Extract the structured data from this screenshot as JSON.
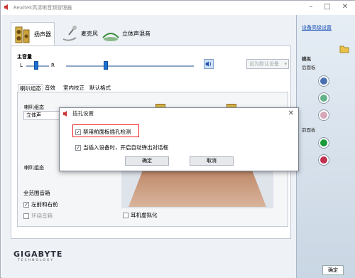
{
  "window": {
    "title": "Realtek高清晰音频管理器"
  },
  "device_tabs": [
    {
      "label": "扬声器"
    },
    {
      "label": "麦克风"
    },
    {
      "label": "立体声混音"
    }
  ],
  "master_volume": {
    "label": "主音量",
    "left": "L",
    "right": "R",
    "set_default_label": "设为默认设备"
  },
  "sub_tabs": [
    {
      "label": "喇叭组态"
    },
    {
      "label": "音效"
    },
    {
      "label": "室内校正"
    },
    {
      "label": "默认格式"
    }
  ],
  "speaker_config": {
    "label": "喇叭组态",
    "value": "立体声",
    "second_label": "喇叭组态",
    "fullrange_title": "全范围音箱",
    "front_lr": "左前和右前",
    "surround": "环绕音箱",
    "headphone_virtualization": "耳机虚拟化"
  },
  "dialog": {
    "title": "插孔设置",
    "option1": "禁用前面板插孔检测",
    "option2": "当插入设备时，开启自动弹出对话框",
    "ok": "确定",
    "cancel": "取消"
  },
  "right_panel": {
    "link": "设备高级设置",
    "analog": "模拟",
    "back_panel": "后面板",
    "front_panel": "前面板"
  },
  "brand": {
    "name": "GIGABYTE",
    "tagline": "TECHNOLOGY"
  },
  "ok_button": "确定",
  "colors": {
    "accent": "#1d6fd2",
    "jack_blue": "#4a6fb0",
    "jack_green": "#63b28a",
    "jack_pink": "#d6a6b8",
    "jack_green_front": "#1a9a3a",
    "jack_red_front": "#c03050"
  }
}
